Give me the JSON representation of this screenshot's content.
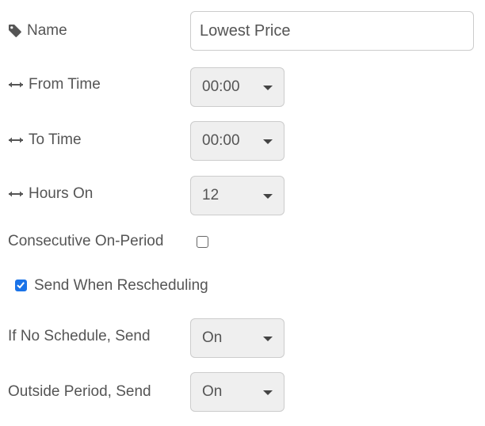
{
  "form": {
    "name": {
      "icon": "tag-icon",
      "label": "Name",
      "value": "Lowest Price"
    },
    "from_time": {
      "icon": "horizontal-arrows-icon",
      "label": "From Time",
      "value": "00:00"
    },
    "to_time": {
      "icon": "horizontal-arrows-icon",
      "label": "To Time",
      "value": "00:00"
    },
    "hours_on": {
      "icon": "horizontal-arrows-icon",
      "label": "Hours On",
      "value": "12"
    },
    "consecutive": {
      "label": "Consecutive On-Period",
      "checked": false
    },
    "send_when_rescheduling": {
      "label": "Send When Rescheduling",
      "checked": true
    },
    "if_no_schedule": {
      "label": "If No Schedule, Send",
      "value": "On"
    },
    "outside_period": {
      "label": "Outside Period, Send",
      "value": "On"
    }
  },
  "colors": {
    "text": "#555555",
    "border": "#cccccc",
    "select_bg": "#efefef",
    "checkbox_accent": "#1a73e8"
  }
}
